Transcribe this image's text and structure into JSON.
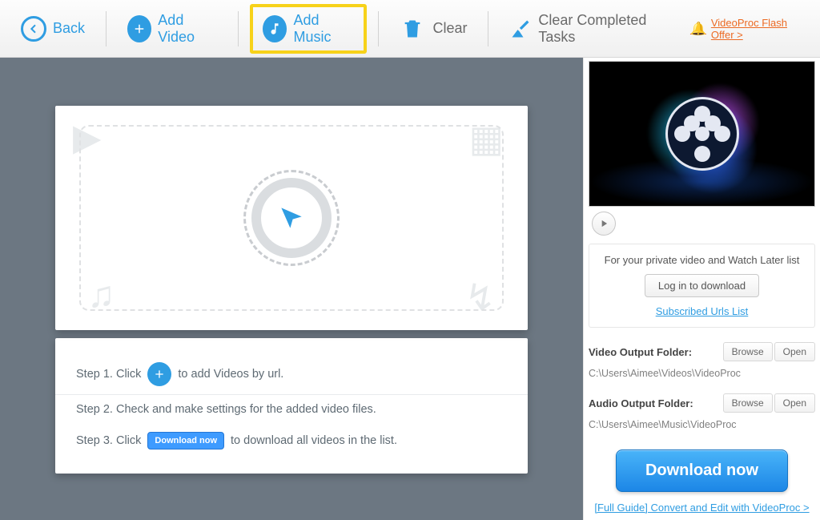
{
  "toolbar": {
    "back": "Back",
    "add_video": "Add Video",
    "add_music": "Add Music",
    "clear": "Clear",
    "clear_completed": "Clear Completed Tasks",
    "promo": "VideoProc Flash Offer >"
  },
  "steps": {
    "s1a": "Step 1. Click",
    "s1b": "to add Videos by url.",
    "s2": "Step 2. Check and make settings for the added video files.",
    "s3a": "Step 3. Click",
    "s3_btn": "Download now",
    "s3b": "to download all videos in the list."
  },
  "right": {
    "private_msg": "For your private video and Watch Later list",
    "login_btn": "Log in to download",
    "sub_link": "Subscribed Urls List",
    "video_folder_label": "Video Output Folder:",
    "video_folder_path": "C:\\Users\\Aimee\\Videos\\VideoProc",
    "audio_folder_label": "Audio Output Folder:",
    "audio_folder_path": "C:\\Users\\Aimee\\Music\\VideoProc",
    "browse": "Browse",
    "open": "Open",
    "download_now": "Download now",
    "guide": "[Full Guide] Convert and Edit with VideoProc >"
  }
}
